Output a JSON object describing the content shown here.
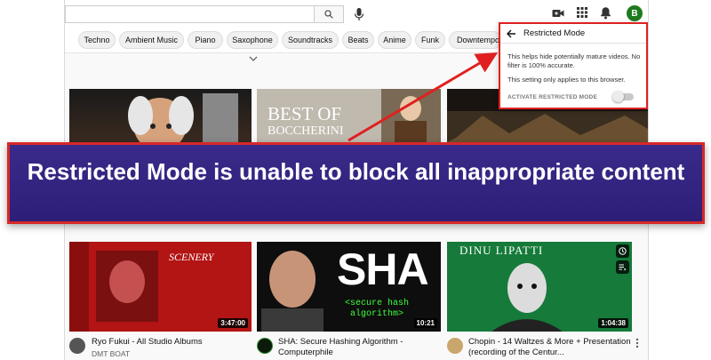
{
  "header": {
    "search_placeholder": "",
    "avatar_letter": "B"
  },
  "chips": [
    "Techno",
    "Ambient Music",
    "Piano",
    "Saxophone",
    "Soundtracks",
    "Beats",
    "Anime",
    "Funk",
    "Downtempo"
  ],
  "restricted_mode": {
    "title": "Restricted Mode",
    "description": "This helps hide potentially mature videos. No filter is 100% accurate.",
    "note": "This setting only applies to this browser.",
    "activate_label": "ACTIVATE RESTRICTED MODE",
    "active": false
  },
  "banner": {
    "text": "Restricted Mode is unable to block all inappropriate content"
  },
  "thumbnail_text": {
    "best_of": "BEST OF",
    "boccherini": "BOCCHERINI",
    "scenery": "SCENERY",
    "sha": "SHA",
    "sha_caption": "<secure hash algorithm>",
    "dinu": "DINU LIPATTI"
  },
  "videos": [
    {
      "title": "Ryo Fukui - All Studio Albums",
      "channel": "DMT BOAT",
      "duration": "3:47:00"
    },
    {
      "title": "SHA: Secure Hashing Algorithm - Computerphile",
      "channel": "",
      "duration": "10:21"
    },
    {
      "title": "Chopin - 14 Waltzes & More + Presentation (recording of the Centur...",
      "channel": "",
      "duration": "1:04:38"
    }
  ]
}
